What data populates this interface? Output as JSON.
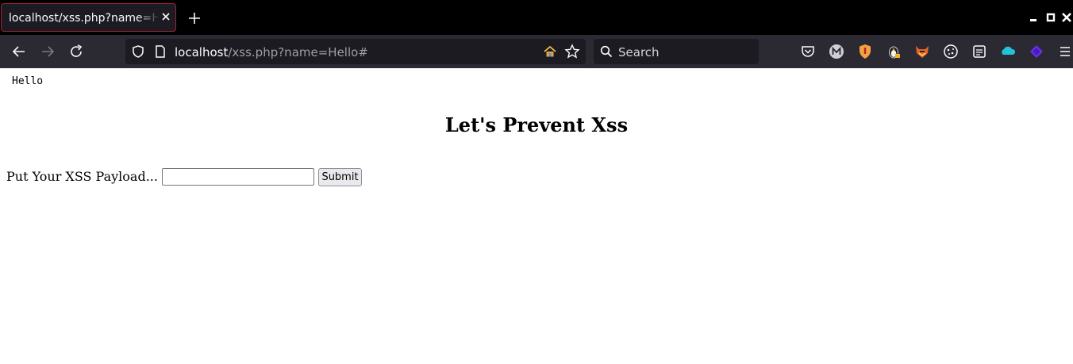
{
  "tab": {
    "title": "localhost/xss.php?name=Hello#"
  },
  "window_controls": {
    "icons": [
      "minimize-icon",
      "maximize-icon",
      "close-icon"
    ]
  },
  "nav": {
    "icons": [
      "back-icon",
      "forward-icon",
      "reload-icon"
    ]
  },
  "url": {
    "host": "localhost",
    "path": "/xss.php?name=Hello#",
    "icons": [
      "tracking-protection-icon",
      "page-info-icon",
      "home-icon",
      "bookmark-star-icon"
    ]
  },
  "search": {
    "placeholder": "Search",
    "icon": "search-icon"
  },
  "toolbar": {
    "icons": [
      "pocket-icon",
      "m-extension-icon",
      "brave-shield-extension-icon",
      "penguin-extension-icon",
      "fox-extension-icon",
      "cookie-extension-icon",
      "reader-view-icon",
      "cloud-extension-icon",
      "diamond-extension-icon",
      "menu-icon"
    ]
  },
  "page": {
    "echo_text": "Hello",
    "heading": "Let's Prevent Xss",
    "form_label": "Put Your XSS Payload...",
    "input_value": "",
    "submit_label": "Submit"
  },
  "colors": {
    "tab_border": "#a0213a",
    "chrome_bg": "#2b2a33",
    "tabstrip_bg": "#000000",
    "url_bg": "#1c1b22"
  }
}
